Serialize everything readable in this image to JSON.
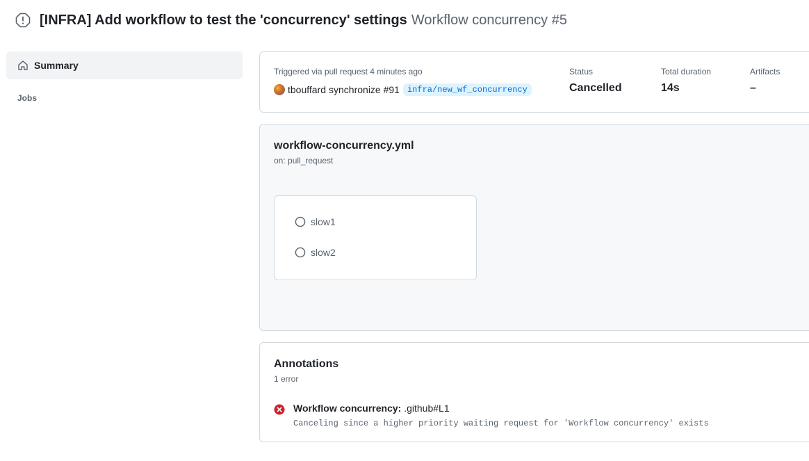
{
  "header": {
    "title": "[INFRA] Add workflow to test the 'concurrency' settings",
    "subtitle": "Workflow concurrency #5",
    "status_icon": "cancelled-icon"
  },
  "sidebar": {
    "summary_label": "Summary",
    "summary_icon": "home-icon",
    "jobs_heading": "Jobs"
  },
  "summary": {
    "trigger_label": "Triggered via pull request 4 minutes ago",
    "actor": "tbouffard",
    "event_text": "synchronize #91",
    "branch": "infra/new_wf_concurrency",
    "status_label": "Status",
    "status_value": "Cancelled",
    "duration_label": "Total duration",
    "duration_value": "14s",
    "artifacts_label": "Artifacts",
    "artifacts_value": "–"
  },
  "workflow": {
    "file": "workflow-concurrency.yml",
    "on": "on: pull_request",
    "jobs": [
      {
        "name": "slow1",
        "icon": "skipped-circle-icon"
      },
      {
        "name": "slow2",
        "icon": "skipped-circle-icon"
      }
    ]
  },
  "annotations": {
    "title": "Annotations",
    "count": "1 error",
    "items": [
      {
        "source": "Workflow concurrency:",
        "location": ".github#L1",
        "message": "Canceling since a higher priority waiting request for 'Workflow concurrency' exists",
        "icon": "error-x-icon"
      }
    ]
  },
  "colors": {
    "error": "#cf222e",
    "link": "#0969da",
    "muted": "#59636e"
  }
}
